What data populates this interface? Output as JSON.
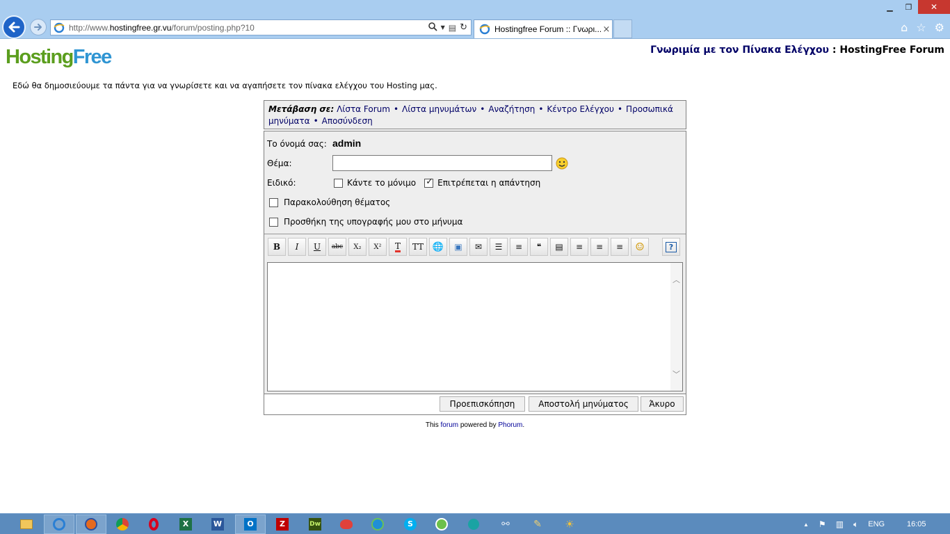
{
  "browser": {
    "url_prefix": "http://www.",
    "url_domain": "hostingfree.gr.vu",
    "url_path": "/forum/posting.php?10",
    "tab_title": "Hostingfree Forum :: Γνωρι...",
    "tab_close": "×"
  },
  "logo": {
    "part1": "Hosting",
    "part2": "Free"
  },
  "header": {
    "section": "Γνωριμία με τον Πίνακα Ελέγχου",
    "separator": ":",
    "forum_name": "HostingFree Forum"
  },
  "intro": "Εδώ θα δημοσιεύουμε τα πάντα για να γνωρίσετε και να αγαπήσετε τον πίνακα ελέγχου του Hosting μας.",
  "nav": {
    "label": "Μετάβαση σε:",
    "separator": "•",
    "links": [
      "Λίστα Forum",
      "Λίστα μηνυμάτων",
      "Αναζήτηση",
      "Κέντρο Ελέγχου",
      "Προσωπικά μηνύματα",
      "Αποσύνδεση"
    ]
  },
  "form": {
    "username_label": "Το όνομά σας:",
    "username_value": "admin",
    "subject_label": "Θέμα:",
    "subject_value": "",
    "special_label": "Ειδικό:",
    "sticky_label": "Κάντε το μόνιμο",
    "sticky_checked": false,
    "allow_reply_label": "Επιτρέπεται η απάντηση",
    "allow_reply_checked": true,
    "follow_topic_label": "Παρακολούθηση θέματος",
    "follow_topic_checked": false,
    "add_signature_label": "Προσθήκη της υπογραφής μου στο μήνυμα",
    "add_signature_checked": false,
    "body_value": ""
  },
  "toolbar": [
    {
      "icon": "bold-icon",
      "glyph": "B"
    },
    {
      "icon": "italic-icon",
      "glyph": "I"
    },
    {
      "icon": "underline-icon",
      "glyph": "U"
    },
    {
      "icon": "strikethrough-icon",
      "glyph": "abc"
    },
    {
      "icon": "subscript-icon",
      "glyph": "X₂"
    },
    {
      "icon": "superscript-icon",
      "glyph": "X²"
    },
    {
      "icon": "text-color-icon",
      "glyph": "T"
    },
    {
      "icon": "text-size-icon",
      "glyph": "TT"
    },
    {
      "icon": "link-icon",
      "glyph": "🌐"
    },
    {
      "icon": "image-icon",
      "glyph": "▣"
    },
    {
      "icon": "email-icon",
      "glyph": "✉"
    },
    {
      "icon": "bullet-list-icon",
      "glyph": "☰"
    },
    {
      "icon": "numbered-list-icon",
      "glyph": "≡"
    },
    {
      "icon": "quote-icon",
      "glyph": "❝"
    },
    {
      "icon": "code-icon",
      "glyph": "▤"
    },
    {
      "icon": "align-left-icon",
      "glyph": "≡"
    },
    {
      "icon": "align-center-icon",
      "glyph": "≡"
    },
    {
      "icon": "align-right-icon",
      "glyph": "≡"
    },
    {
      "icon": "smiley-icon",
      "glyph": "☺"
    }
  ],
  "help_glyph": "?",
  "buttons": {
    "preview": "Προεπισκόπηση",
    "send": "Αποστολή μηνύματος",
    "cancel": "Άκυρο"
  },
  "footer": {
    "prefix": "This",
    "forum_link": "forum",
    "middle": "powered by",
    "phorum_link": "Phorum",
    "suffix": "."
  },
  "tray": {
    "language": "ENG",
    "time": "16:05"
  }
}
